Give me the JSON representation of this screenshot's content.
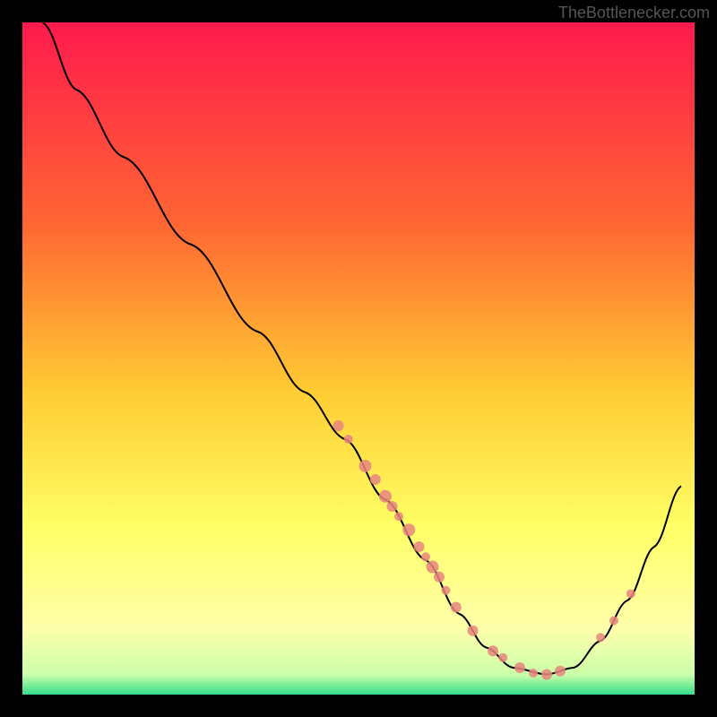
{
  "watermark": "TheBottlenecker.com",
  "chart_data": {
    "type": "line",
    "title": "",
    "xlabel": "",
    "ylabel": "",
    "xlim": [
      0,
      100
    ],
    "ylim": [
      0,
      100
    ],
    "gradient_colors": [
      {
        "stop": 0,
        "color": "#ff1a4d"
      },
      {
        "stop": 30,
        "color": "#ff6633"
      },
      {
        "stop": 55,
        "color": "#ffcc33"
      },
      {
        "stop": 75,
        "color": "#ffff66"
      },
      {
        "stop": 90,
        "color": "#ffffaa"
      },
      {
        "stop": 97,
        "color": "#ccffaa"
      },
      {
        "stop": 100,
        "color": "#33dd88"
      }
    ],
    "curve_points": [
      {
        "x": 3,
        "y": 0
      },
      {
        "x": 8,
        "y": 10
      },
      {
        "x": 15,
        "y": 20
      },
      {
        "x": 25,
        "y": 33
      },
      {
        "x": 35,
        "y": 46
      },
      {
        "x": 42,
        "y": 55
      },
      {
        "x": 48,
        "y": 62
      },
      {
        "x": 54,
        "y": 71
      },
      {
        "x": 60,
        "y": 80
      },
      {
        "x": 65,
        "y": 88
      },
      {
        "x": 69,
        "y": 93
      },
      {
        "x": 73,
        "y": 96
      },
      {
        "x": 78,
        "y": 97
      },
      {
        "x": 82,
        "y": 96
      },
      {
        "x": 86,
        "y": 92
      },
      {
        "x": 90,
        "y": 86
      },
      {
        "x": 94,
        "y": 78
      },
      {
        "x": 98,
        "y": 69
      }
    ],
    "data_points": [
      {
        "x": 47,
        "y": 60,
        "r": 6
      },
      {
        "x": 48.5,
        "y": 62,
        "r": 5
      },
      {
        "x": 51,
        "y": 66,
        "r": 7
      },
      {
        "x": 52.5,
        "y": 68,
        "r": 6
      },
      {
        "x": 54,
        "y": 70.5,
        "r": 7
      },
      {
        "x": 55,
        "y": 72,
        "r": 6
      },
      {
        "x": 56,
        "y": 73.5,
        "r": 5
      },
      {
        "x": 57.5,
        "y": 75.5,
        "r": 7
      },
      {
        "x": 59,
        "y": 78,
        "r": 6
      },
      {
        "x": 60,
        "y": 79.5,
        "r": 5
      },
      {
        "x": 61,
        "y": 81,
        "r": 7
      },
      {
        "x": 62,
        "y": 82.5,
        "r": 6
      },
      {
        "x": 63,
        "y": 84.5,
        "r": 5
      },
      {
        "x": 64.5,
        "y": 87,
        "r": 6
      },
      {
        "x": 67,
        "y": 90.5,
        "r": 6
      },
      {
        "x": 70,
        "y": 93.5,
        "r": 6
      },
      {
        "x": 71.5,
        "y": 94.5,
        "r": 5
      },
      {
        "x": 74,
        "y": 96,
        "r": 6
      },
      {
        "x": 76,
        "y": 96.8,
        "r": 5
      },
      {
        "x": 78,
        "y": 97,
        "r": 6
      },
      {
        "x": 80,
        "y": 96.5,
        "r": 6
      },
      {
        "x": 86,
        "y": 91.5,
        "r": 5
      },
      {
        "x": 88,
        "y": 89,
        "r": 5
      },
      {
        "x": 90.5,
        "y": 85,
        "r": 5
      }
    ]
  }
}
